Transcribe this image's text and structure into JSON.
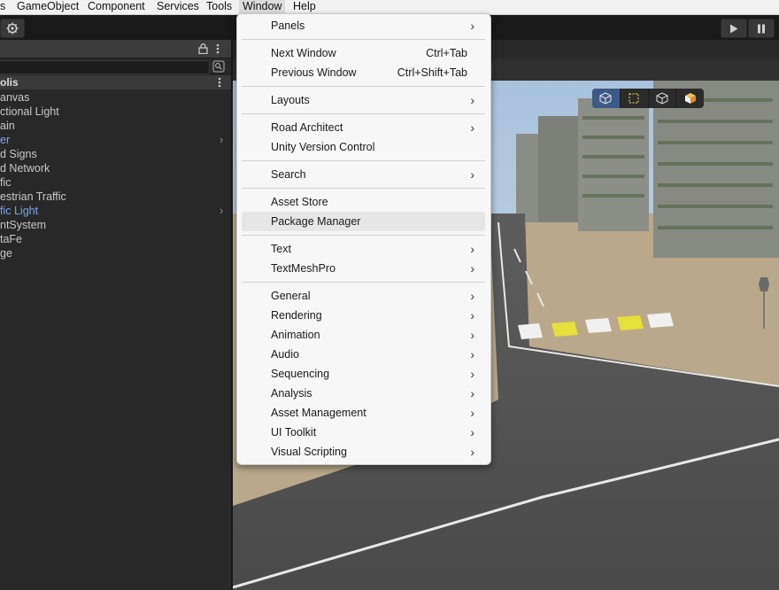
{
  "menubar": {
    "items": [
      {
        "label": "s"
      },
      {
        "label": "GameObject"
      },
      {
        "label": "Component"
      },
      {
        "label": "Services"
      },
      {
        "label": "Tools"
      },
      {
        "label": "Window"
      },
      {
        "label": "Help"
      }
    ]
  },
  "toolbar": {
    "settings_icon": "gear-icon",
    "play_icon": "play-icon",
    "pause_icon": "pause-icon"
  },
  "hierarchy": {
    "scene_name": "olis",
    "items": [
      {
        "label": "anvas"
      },
      {
        "label": "ctional Light"
      },
      {
        "label": "ain"
      },
      {
        "label": "er"
      },
      {
        "label": "d Signs"
      },
      {
        "label": "d Network"
      },
      {
        "label": "fic"
      },
      {
        "label": "estrian Traffic"
      },
      {
        "label": "fic Light"
      },
      {
        "label": "ntSystem"
      },
      {
        "label": "taFe"
      },
      {
        "label": "ge"
      }
    ]
  },
  "window_menu": {
    "items": [
      {
        "label": "Panels",
        "submenu": true
      },
      {
        "label": "Next Window",
        "shortcut": "Ctrl+Tab"
      },
      {
        "label": "Previous Window",
        "shortcut": "Ctrl+Shift+Tab"
      },
      {
        "label": "Layouts",
        "submenu": true
      },
      {
        "label": "Road Architect",
        "submenu": true
      },
      {
        "label": "Unity Version Control"
      },
      {
        "label": "Search",
        "submenu": true
      },
      {
        "label": "Asset Store"
      },
      {
        "label": "Package Manager"
      },
      {
        "label": "Text",
        "submenu": true
      },
      {
        "label": "TextMeshPro",
        "submenu": true
      },
      {
        "label": "General",
        "submenu": true
      },
      {
        "label": "Rendering",
        "submenu": true
      },
      {
        "label": "Animation",
        "submenu": true
      },
      {
        "label": "Audio",
        "submenu": true
      },
      {
        "label": "Sequencing",
        "submenu": true
      },
      {
        "label": "Analysis",
        "submenu": true
      },
      {
        "label": "Asset Management",
        "submenu": true
      },
      {
        "label": "UI Toolkit",
        "submenu": true
      },
      {
        "label": "Visual Scripting",
        "submenu": true
      }
    ],
    "submenu_arrow": "›"
  }
}
